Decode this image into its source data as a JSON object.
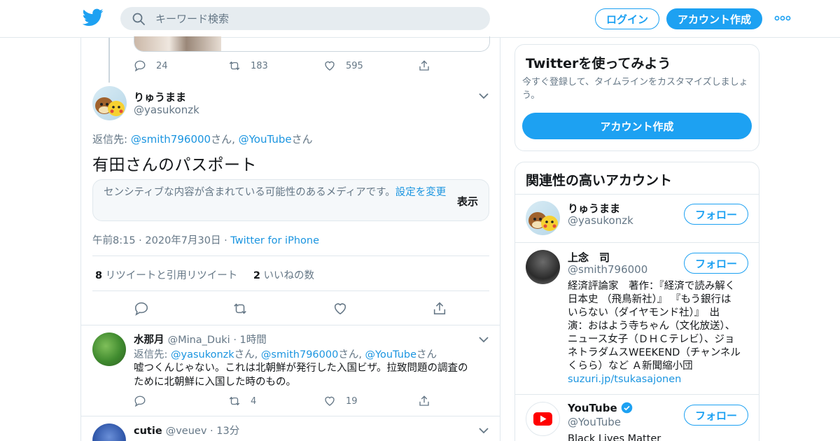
{
  "header": {
    "search_placeholder": "キーワード検索",
    "login_label": "ログイン",
    "signup_label": "アカウント作成",
    "brand_color": "#1da1f2"
  },
  "prev_tweet": {
    "reply_count": "24",
    "retweet_count": "183",
    "like_count": "595"
  },
  "main_tweet": {
    "name": "りゅうまま",
    "handle": "@yasukonzk",
    "reply_prefix": "返信先: ",
    "reply_to_1": "@smith796000",
    "reply_sep_1": "さん, ",
    "reply_to_2": "@YouTube",
    "reply_suffix": "さん",
    "text": "有田さんのパスポート",
    "sensitive_text": "センシティブな内容が含まれている可能性のあるメディアです。",
    "sensitive_link": "設定を変更",
    "show_label": "表示",
    "time": "午前8:15",
    "date": "2020年7月30日",
    "source": "Twitter for iPhone",
    "retweet_count": "8",
    "retweet_label": "リツイートと引用リツイート",
    "like_count": "2",
    "like_label": "いいねの数"
  },
  "replies": [
    {
      "name": "水那月",
      "handle": "@Mina_Duki",
      "time": "1時間",
      "reply_prefix": "返信先: ",
      "reply_to_1": "@yasukonzk",
      "reply_sep_1": "さん, ",
      "reply_to_2": "@smith796000",
      "reply_sep_2": "さん, ",
      "reply_to_3": "@YouTube",
      "reply_suffix": "さん",
      "text_line1": "嘘つくんじゃない。これは北朝鮮が発行した入国ビザ。拉致問題の調査の",
      "text_line2": "ために北朝鮮に入国した時のもの。",
      "retweet_count": "4",
      "like_count": "19"
    },
    {
      "name": "cutie",
      "handle": "@veuev",
      "time": "13分"
    }
  ],
  "sidebar": {
    "try_title": "Twitterを使ってみよう",
    "try_sub_line1": "今すぐ登録して、タイムラインをカスタマイズしましょ",
    "try_sub_line2": "う。",
    "try_button": "アカウント作成",
    "related_title": "関連性の高いアカウント",
    "follow_label": "フォロー",
    "accounts": [
      {
        "name": "りゅうまま",
        "handle": "@yasukonzk"
      },
      {
        "name": "上念　司",
        "handle": "@smith796000",
        "bio": [
          "経済評論家　著作：『経済で読み解く",
          "日本史 （飛鳥新社）』 『もう銀行は",
          "いらない（ダイヤモンド社）』　出",
          "演：おはよう寺ちゃん（文化放送）、",
          "ニュース女子（ＤＨＣテレビ）、ジョ",
          "ネトラダムスWEEKEND（チャンネル",
          "くらら）など Ａ新聞縮小団"
        ],
        "link": "suzuri.jp/tsukasajonen"
      },
      {
        "name": "YouTube",
        "handle": "@YouTube",
        "bio_first": "Black Lives Matter"
      }
    ]
  }
}
